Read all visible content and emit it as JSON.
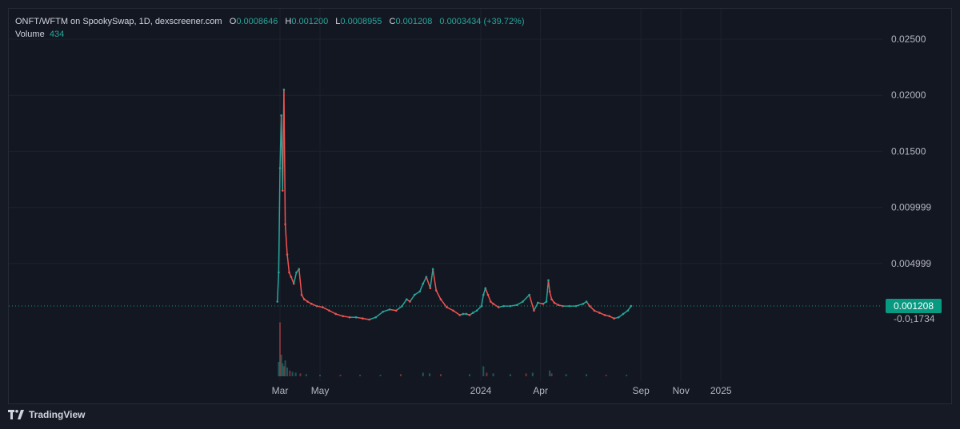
{
  "header": {
    "symbol": "ONFT/WFTM on SpookySwap, 1D, dexscreener.com",
    "o_label": "O",
    "o_value": "0.0008646",
    "h_label": "H",
    "h_value": "0.001200",
    "l_label": "L",
    "l_value": "0.0008955",
    "c_label": "C",
    "c_value": "0.001208",
    "change": "0.0003434 (+39.72%)",
    "volume_label": "Volume",
    "volume_value": "434"
  },
  "footer": {
    "brand": "TradingView",
    "logo_icon": "tradingview-logo-icon"
  },
  "colors": {
    "up": "#26a69a",
    "down": "#ef5350",
    "background": "#131722",
    "grid": "#1e222d",
    "last_price": "#089981"
  },
  "chart_data": {
    "type": "line",
    "title": "ONFT/WFTM on SpookySwap, 1D, dexscreener.com",
    "xlabel": "",
    "ylabel": "",
    "x_tick_labels": [
      "Mar",
      "May",
      "2024",
      "Apr",
      "Sep",
      "Nov",
      "2025"
    ],
    "y_tick_labels": [
      "0.02500",
      "0.02000",
      "0.01500",
      "0.009999",
      "0.004999"
    ],
    "ylim": [
      -0.0005,
      0.0265
    ],
    "last_price_label": "0.001208",
    "below_label": "-0.0₁1734",
    "grid": true,
    "legend": "top-left",
    "series": [
      {
        "x": [
          "2023-02-25",
          "2023-02-27",
          "2023-03-01",
          "2023-03-03",
          "2023-03-05",
          "2023-03-07",
          "2023-03-09",
          "2023-03-12",
          "2023-03-15",
          "2023-03-18",
          "2023-03-22",
          "2023-03-26",
          "2023-03-30",
          "2023-04-03",
          "2023-04-07",
          "2023-04-12",
          "2023-04-18",
          "2023-04-26",
          "2023-05-05",
          "2023-05-15",
          "2023-05-25",
          "2023-06-05",
          "2023-06-15",
          "2023-06-25",
          "2023-07-05",
          "2023-07-15",
          "2023-07-25",
          "2023-08-05",
          "2023-08-15",
          "2023-08-25",
          "2023-09-03",
          "2023-09-10",
          "2023-09-15",
          "2023-09-22",
          "2023-09-30",
          "2023-10-05",
          "2023-10-10",
          "2023-10-16",
          "2023-10-20",
          "2023-10-25",
          "2023-11-01",
          "2023-11-10",
          "2023-11-20",
          "2023-11-30",
          "2023-12-05",
          "2023-12-10",
          "2023-12-15",
          "2023-12-20",
          "2023-12-26",
          "2024-01-02",
          "2024-01-05",
          "2024-01-08",
          "2024-01-12",
          "2024-01-16",
          "2024-01-20",
          "2024-01-28",
          "2024-02-05",
          "2024-02-15",
          "2024-02-25",
          "2024-03-05",
          "2024-03-15",
          "2024-03-22",
          "2024-03-28",
          "2024-04-05",
          "2024-04-10",
          "2024-04-13",
          "2024-04-15",
          "2024-04-18",
          "2024-04-22",
          "2024-04-28",
          "2024-05-05",
          "2024-05-15",
          "2024-05-25",
          "2024-06-05",
          "2024-06-10",
          "2024-06-15",
          "2024-06-22",
          "2024-06-30",
          "2024-07-08",
          "2024-07-15",
          "2024-07-22",
          "2024-07-29",
          "2024-08-05",
          "2024-08-12",
          "2024-08-17"
        ],
        "values": [
          0.0016,
          0.0042,
          0.0135,
          0.0182,
          0.0115,
          0.0205,
          0.0085,
          0.0058,
          0.0042,
          0.0038,
          0.0032,
          0.0042,
          0.0045,
          0.0022,
          0.0018,
          0.0016,
          0.0014,
          0.0012,
          0.0011,
          0.0008,
          0.0005,
          0.0003,
          0.0002,
          0.0002,
          0.0001,
          0.0,
          0.0002,
          0.0007,
          0.0009,
          0.0008,
          0.0012,
          0.0018,
          0.0016,
          0.0022,
          0.0025,
          0.0032,
          0.0038,
          0.0028,
          0.0045,
          0.0026,
          0.0018,
          0.0011,
          0.0008,
          0.0004,
          0.0005,
          0.0005,
          0.0004,
          0.0006,
          0.0008,
          0.0012,
          0.0022,
          0.0028,
          0.0022,
          0.0016,
          0.0014,
          0.0011,
          0.0012,
          0.0012,
          0.0013,
          0.0016,
          0.0022,
          0.0008,
          0.0015,
          0.0014,
          0.0016,
          0.0035,
          0.0025,
          0.0018,
          0.0015,
          0.0013,
          0.0012,
          0.0012,
          0.0012,
          0.0014,
          0.0016,
          0.0012,
          0.0008,
          0.0006,
          0.0004,
          0.0003,
          0.0001,
          0.0002,
          0.0005,
          0.0008,
          0.001208
        ]
      }
    ],
    "volume": {
      "x": [
        "2023-02-27",
        "2023-03-01",
        "2023-03-03",
        "2023-03-05",
        "2023-03-07",
        "2023-03-09",
        "2023-03-12",
        "2023-03-16",
        "2023-03-20",
        "2023-03-25",
        "2023-04-01",
        "2023-04-10",
        "2023-05-01",
        "2023-06-01",
        "2023-07-01",
        "2023-08-01",
        "2023-09-01",
        "2023-10-05",
        "2023-10-15",
        "2023-11-01",
        "2023-12-15",
        "2024-01-05",
        "2024-01-10",
        "2024-01-20",
        "2024-02-15",
        "2024-03-10",
        "2024-03-20",
        "2024-04-15",
        "2024-04-18",
        "2024-05-10",
        "2024-06-10",
        "2024-07-10",
        "2024-08-10"
      ],
      "values": [
        20,
        75,
        30,
        18,
        14,
        22,
        12,
        8,
        6,
        5,
        4,
        3,
        2,
        2,
        2,
        2,
        3,
        5,
        4,
        3,
        3,
        14,
        5,
        4,
        3,
        4,
        5,
        8,
        4,
        3,
        3,
        2,
        2
      ]
    }
  }
}
